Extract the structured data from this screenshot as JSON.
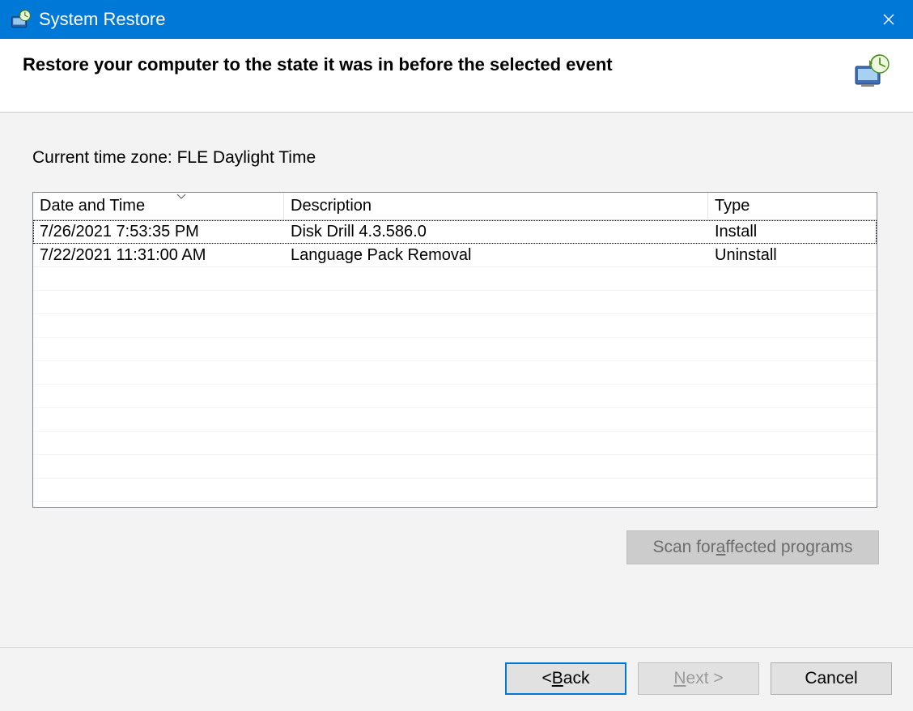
{
  "titlebar": {
    "title": "System Restore"
  },
  "header": {
    "heading": "Restore your computer to the state it was in before the selected event"
  },
  "body": {
    "timezone_label": "Current time zone: FLE Daylight Time",
    "columns": {
      "date": "Date and Time",
      "description": "Description",
      "type": "Type"
    },
    "rows": [
      {
        "date": "7/26/2021 7:53:35 PM",
        "description": "Disk Drill 4.3.586.0",
        "type": "Install"
      },
      {
        "date": "7/22/2021 11:31:00 AM",
        "description": "Language Pack Removal",
        "type": "Uninstall"
      }
    ],
    "scan_button": {
      "prefix": "Scan for ",
      "accel": "a",
      "suffix": "ffected programs"
    }
  },
  "footer": {
    "back": {
      "prefix": "< ",
      "accel": "B",
      "suffix": "ack"
    },
    "next": {
      "prefix": "",
      "accel": "N",
      "suffix": "ext >"
    },
    "cancel": "Cancel"
  }
}
